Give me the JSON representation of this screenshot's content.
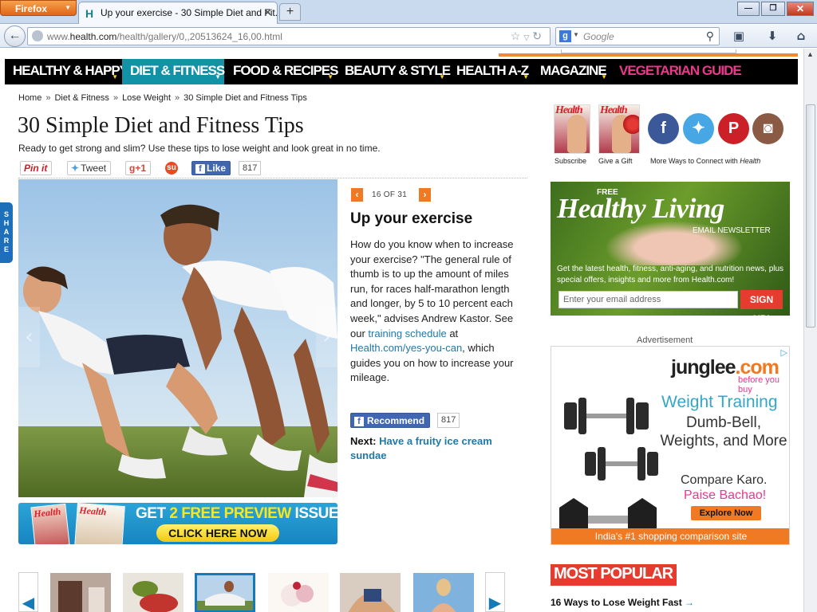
{
  "browser": {
    "app_button": "Firefox",
    "tab_title": "Up your exercise - 30 Simple Diet and Fit...",
    "tab_favicon": "H",
    "url_prefix": "www.",
    "url_domain": "health.com",
    "url_path": "/health/gallery/0,,20513624_16,00.html",
    "search_engine_glyph": "g",
    "search_placeholder": "Google",
    "window_buttons": {
      "minimize": "—",
      "restore": "❐",
      "close": "✕"
    }
  },
  "nav": {
    "items": [
      {
        "label": "HEALTHY & HAPPY"
      },
      {
        "label": "DIET & FITNESS"
      },
      {
        "label": "FOOD & RECIPES"
      },
      {
        "label": "BEAUTY & STYLE"
      },
      {
        "label": "HEALTH A-Z"
      },
      {
        "label": "MAGAZINE"
      },
      {
        "label": "VEGETARIAN GUIDE"
      }
    ],
    "active_index": 1,
    "accent": "#1292a6",
    "highlight_color": "#e8398b"
  },
  "breadcrumb": {
    "items": [
      "Home",
      "Diet & Fitness",
      "Lose Weight",
      "30 Simple Diet and Fitness Tips"
    ],
    "separator": "»"
  },
  "article": {
    "title": "30 Simple Diet and Fitness Tips",
    "subtitle": "Ready to get strong and slim? Use these tips to lose weight and look great in no time."
  },
  "social": {
    "pin": "Pin it",
    "tweet": "Tweet",
    "gplus": "+1",
    "like": "Like",
    "like_count": "817"
  },
  "share_tab": "SHARE",
  "slide": {
    "counter": "16 OF 31",
    "title": "Up your exercise",
    "body_1": "How do you know when to increase your exercise? \"The general rule of thumb is to up the amount of miles run, for races half-marathon length and longer, by 5 to 10 percent each week,\" advises Andrew Kastor. See our ",
    "link_1": "training schedule",
    "body_2": " at ",
    "link_2": "Health.com/yes-you-can",
    "body_3": ", which guides you on how to increase your mileage.",
    "recommend": "Recommend",
    "recommend_count": "817",
    "next_label": "Next:",
    "next_link": "Have a fruity ice cream sundae"
  },
  "preview_banner": {
    "title_pre": "GET ",
    "title_hl": "2 FREE PREVIEW",
    "title_post": " ISSUES!",
    "cta": "CLICK HERE NOW",
    "mag_title": "Health"
  },
  "right": {
    "subscribe": "Subscribe",
    "gift": "Give a Gift",
    "more_ways": "More Ways to Connect with ",
    "more_ways_brand": "Health",
    "mag_title": "Health"
  },
  "newsletter": {
    "free": "FREE",
    "title": "Healthy Living",
    "label": "EMAIL NEWSLETTER",
    "desc": "Get the latest health, fitness, anti-aging, and nutrition news, plus special offers, insights and more from Health.com!",
    "placeholder": "Enter your email address",
    "button": "SIGN UP!"
  },
  "ad": {
    "label": "Advertisement",
    "logo_main": "junglee",
    "logo_dot": ".com",
    "tagline": "before you buy",
    "h1": "Weight Training",
    "h2": "Dumb-Bell, Weights, and More",
    "h3": "Compare Karo.",
    "h4": "Paise Bachao!",
    "button": "Explore Now",
    "footer": "India's #1 shopping comparison site"
  },
  "most_popular": {
    "heading": "MOST POPULAR",
    "first_item": "16 Ways to Lose Weight Fast"
  },
  "icons": {
    "back": "back-arrow-icon",
    "bookmark_star": "star-icon",
    "reload": "reload-icon",
    "search": "magnifier-icon",
    "downloads": "download-icon",
    "home": "home-icon",
    "facebook": "facebook-icon",
    "twitter": "twitter-icon",
    "pinterest": "pinterest-icon",
    "instagram": "instagram-icon"
  }
}
